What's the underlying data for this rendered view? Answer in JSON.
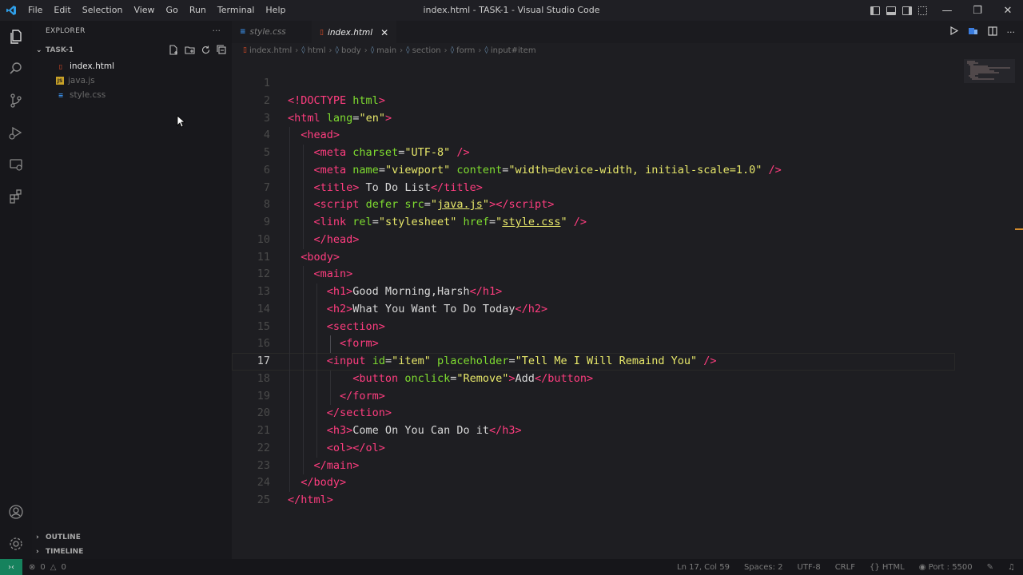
{
  "window": {
    "title": "index.html - TASK-1 - Visual Studio Code",
    "menu": [
      "File",
      "Edit",
      "Selection",
      "View",
      "Go",
      "Run",
      "Terminal",
      "Help"
    ]
  },
  "sidebar": {
    "header": "EXPLORER",
    "more": "···",
    "folder": "TASK-1",
    "files": [
      {
        "name": "index.html",
        "icon": "html-file-icon",
        "color": "#e8e8e8"
      },
      {
        "name": "java.js",
        "icon": "js-file-icon",
        "color": "#6b6b6b"
      },
      {
        "name": "style.css",
        "icon": "css-file-icon",
        "color": "#6b6b6b"
      }
    ],
    "outline": "OUTLINE",
    "timeline": "TIMELINE"
  },
  "tabs": [
    {
      "label": "style.css",
      "active": false
    },
    {
      "label": "index.html",
      "active": true
    }
  ],
  "breadcrumbs": [
    "index.html",
    "html",
    "body",
    "main",
    "section",
    "form",
    "input#item"
  ],
  "editor": {
    "current_line": 17
  },
  "status": {
    "errors": "0",
    "warnings": "0",
    "position": "Ln 17, Col 59",
    "spaces": "Spaces: 2",
    "encoding": "UTF-8",
    "eol": "CRLF",
    "language": "HTML",
    "port": "Port : 5500"
  },
  "colors": {
    "tag": "#ff3d7f",
    "attribute": "#7fdc30",
    "string": "#e8e86a",
    "remote": "#16825d"
  }
}
